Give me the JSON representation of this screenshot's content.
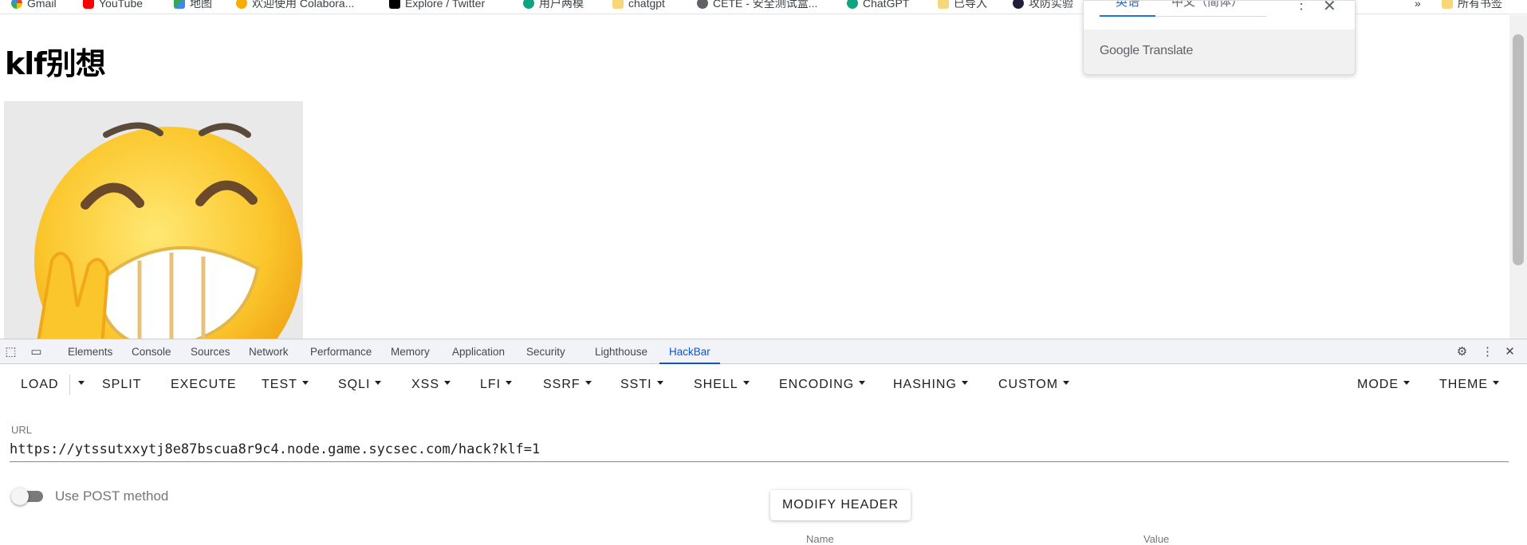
{
  "bookmarks": [
    {
      "label": "Gmail",
      "icon": "gmail-icon"
    },
    {
      "label": "YouTube",
      "icon": "youtube-icon"
    },
    {
      "label": "地图",
      "icon": "maps-icon"
    },
    {
      "label": "欢迎使用 Colabora...",
      "icon": "colab-icon"
    },
    {
      "label": "Explore / Twitter",
      "icon": "x-icon"
    },
    {
      "label": "用户两模",
      "icon": "chatgpt-icon"
    },
    {
      "label": "chatgpt",
      "icon": "folder-icon"
    },
    {
      "label": "CETE - 安全测试盒...",
      "icon": "ctf-icon"
    },
    {
      "label": "ChatGPT",
      "icon": "chatgpt-icon"
    },
    {
      "label": "已导入",
      "icon": "folder-icon"
    },
    {
      "label": "攻防实验",
      "icon": "site-icon"
    },
    {
      "label": "»",
      "icon": ""
    },
    {
      "label": "所有书签",
      "icon": "folder-icon"
    }
  ],
  "page": {
    "heading": "klf别想"
  },
  "translate": {
    "source_lang": "英语",
    "target_lang": "中文（简体）",
    "brand": "Google Translate"
  },
  "devtools": {
    "tabs": [
      "Elements",
      "Console",
      "Sources",
      "Network",
      "Performance",
      "Memory",
      "Application",
      "Security",
      "Lighthouse",
      "HackBar"
    ],
    "active_tab": "HackBar"
  },
  "hackbar": {
    "toolbar": {
      "load": "LOAD",
      "split": "SPLIT",
      "execute": "EXECUTE",
      "test": "TEST",
      "sqli": "SQLI",
      "xss": "XSS",
      "lfi": "LFI",
      "ssrf": "SSRF",
      "ssti": "SSTI",
      "shell": "SHELL",
      "encoding": "ENCODING",
      "hashing": "HASHING",
      "custom": "CUSTOM",
      "mode": "MODE",
      "theme": "THEME"
    },
    "url_label": "URL",
    "url_value": "https://ytssutxxytj8e87bscua8r9c4.node.game.sycsec.com/hack?klf=1",
    "post_label": "Use POST method",
    "post_enabled": false,
    "modify_header": "MODIFY HEADER",
    "columns": {
      "name": "Name",
      "value": "Value"
    }
  }
}
